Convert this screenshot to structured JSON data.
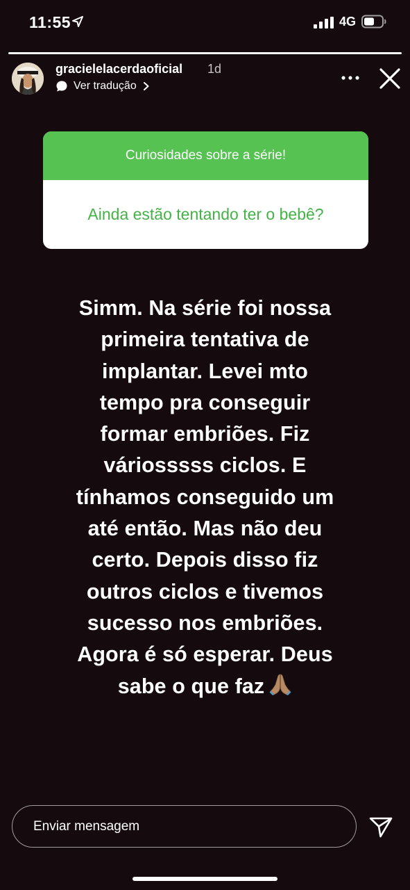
{
  "status_bar": {
    "time": "11:55",
    "network": "4G",
    "location_icon": "location-arrow-icon",
    "signal_icon": "cellular-signal-icon",
    "battery_icon": "battery-icon"
  },
  "story": {
    "progress": 1.0,
    "username": "gracielelacerdaoficial",
    "age": "1d",
    "translate_label": "Ver tradução",
    "avatar_icon": "profile-avatar"
  },
  "question_card": {
    "header": "Curiosidades sobre a série!",
    "question": "Ainda estão tentando ter o bebê?",
    "header_color": "#55c252",
    "question_color": "#44b346"
  },
  "answer": {
    "lines": [
      "Simm. Na série foi nossa",
      "primeira tentativa de",
      "implantar. Levei mto",
      "tempo pra conseguir",
      "formar embriões. Fiz",
      "váriosssss ciclos. E",
      "tínhamos conseguido um",
      "até então. Mas não deu",
      "certo. Depois disso fiz",
      "outros ciclos e tivemos",
      "sucesso nos embriões.",
      "Agora é só esperar. Deus",
      "sabe o que faz"
    ],
    "emoji_icon": "praying-hands-icon"
  },
  "footer": {
    "message_placeholder": "Enviar mensagem",
    "send_icon": "send-icon"
  }
}
